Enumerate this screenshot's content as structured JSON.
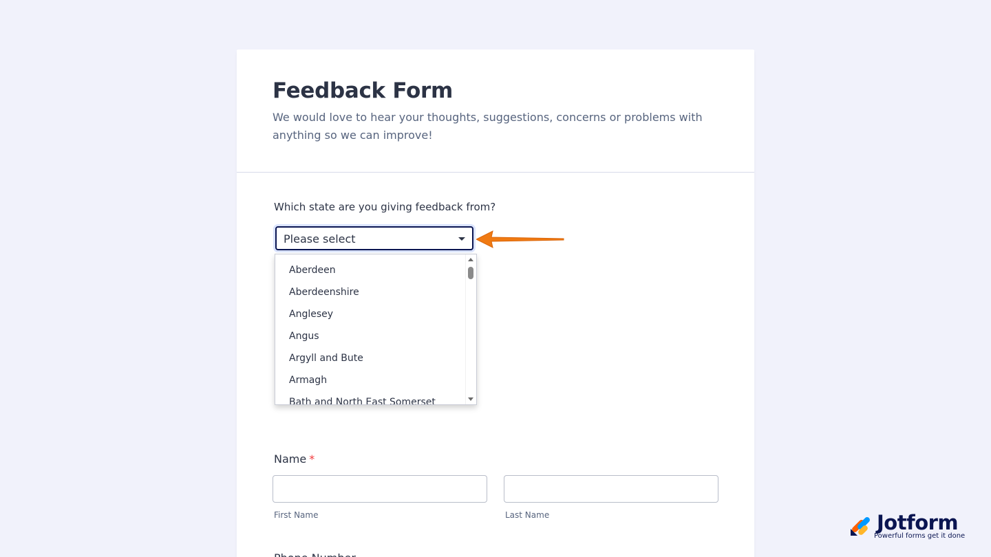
{
  "form": {
    "title": "Feedback Form",
    "subtitle": "We would love to hear your thoughts, suggestions, concerns or problems with anything so we can improve!"
  },
  "state_question": {
    "label": "Which state are you giving feedback from?",
    "selected": "Please select",
    "options": [
      "Aberdeen",
      "Aberdeenshire",
      "Anglesey",
      "Angus",
      "Argyll and Bute",
      "Armagh",
      "Bath and North East Somerset"
    ]
  },
  "name_question": {
    "label": "Name",
    "required_marker": "*",
    "first_sublabel": "First Name",
    "last_sublabel": "Last Name"
  },
  "next_question": {
    "label": "Phone Number"
  },
  "branding": {
    "name": "Jotform",
    "tagline": "Powerful forms get it done"
  },
  "colors": {
    "background": "#f1f2fb",
    "arrow": "#f07a12",
    "select_border": "#0a1551",
    "required": "#f23a3c"
  }
}
